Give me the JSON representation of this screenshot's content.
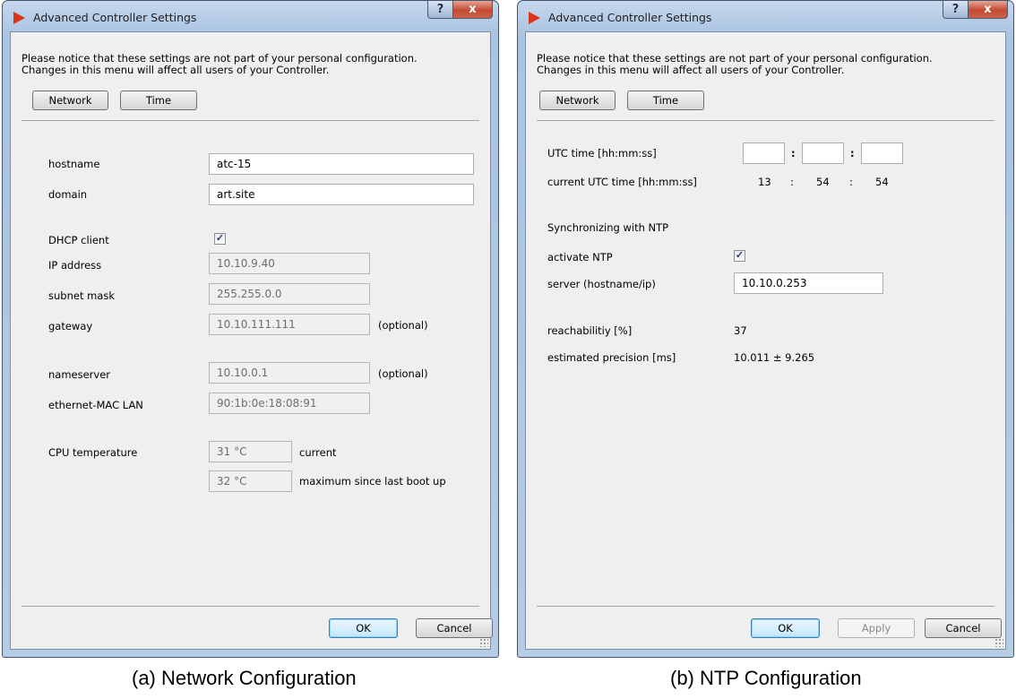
{
  "network_window": {
    "title": "Advanced Controller Settings",
    "notice_line1": "Please notice that these settings are not part of your personal configuration.",
    "notice_line2": "Changes in this menu will affect all users of your Controller.",
    "tabs": {
      "network": "Network",
      "time": "Time"
    },
    "hostname": {
      "label": "hostname",
      "value": "atc-15"
    },
    "domain": {
      "label": "domain",
      "value": "art.site"
    },
    "dhcp": {
      "label": "DHCP client",
      "checked": true
    },
    "ip_address": {
      "label": "IP address",
      "value": "10.10.9.40"
    },
    "subnet_mask": {
      "label": "subnet mask",
      "value": "255.255.0.0"
    },
    "gateway": {
      "label": "gateway",
      "value": "10.10.111.111",
      "note": "(optional)"
    },
    "nameserver": {
      "label": "nameserver",
      "value": "10.10.0.1",
      "note": "(optional)"
    },
    "mac": {
      "label": "ethernet-MAC LAN",
      "value": "90:1b:0e:18:08:91"
    },
    "cpu": {
      "label": "CPU temperature",
      "current_value": "31 °C",
      "current_note": "current",
      "max_value": "32 °C",
      "max_note": "maximum since last boot up"
    },
    "buttons": {
      "ok": "OK",
      "cancel": "Cancel"
    }
  },
  "ntp_window": {
    "title": "Advanced Controller Settings",
    "notice_line1": "Please notice that these settings are not part of your personal configuration.",
    "notice_line2": "Changes in this menu will affect all users of your Controller.",
    "tabs": {
      "network": "Network",
      "time": "Time"
    },
    "utc_time": {
      "label": "UTC time [hh:mm:ss]",
      "hh": "",
      "mm": "",
      "ss": "",
      "sep": ":"
    },
    "current_utc": {
      "label": "current UTC time [hh:mm:ss]",
      "hh": "13",
      "mm": "54",
      "ss": "54",
      "sep": ":"
    },
    "sync_heading": "Synchronizing with NTP",
    "activate_ntp": {
      "label": "activate NTP",
      "checked": true
    },
    "server": {
      "label": "server (hostname/ip)",
      "value": "10.10.0.253"
    },
    "reachability": {
      "label": "reachabilitiy [%]",
      "value": "37"
    },
    "precision": {
      "label": "estimated precision [ms]",
      "value": "10.011 ± 9.265"
    },
    "buttons": {
      "ok": "OK",
      "apply": "Apply",
      "cancel": "Cancel"
    }
  },
  "captions": {
    "left": "(a)  Network Configuration",
    "right": "(b)  NTP Configuration"
  },
  "icons": {
    "check": "✓",
    "help": "?",
    "close": "x"
  }
}
